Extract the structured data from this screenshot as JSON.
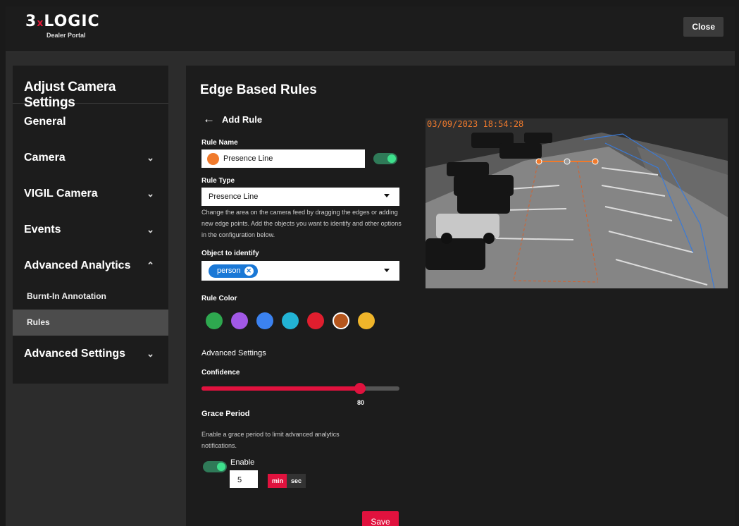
{
  "header": {
    "logo_main_a": "3",
    "logo_x": "x",
    "logo_main_b": "LOGIC",
    "logo_sub": "Dealer Portal",
    "close_label": "Close"
  },
  "sidebar": {
    "title": "Adjust Camera Settings",
    "items": [
      {
        "label": "General",
        "chevron": ""
      },
      {
        "label": "Camera",
        "chevron": "⌄"
      },
      {
        "label": "VIGIL Camera",
        "chevron": "⌄"
      },
      {
        "label": "Events",
        "chevron": "⌄"
      },
      {
        "label": "Advanced Analytics",
        "chevron": "⌃"
      }
    ],
    "subitems": [
      {
        "label": "Burnt-In Annotation",
        "active": false
      },
      {
        "label": "Rules",
        "active": true
      }
    ],
    "bottom_item": {
      "label": "Advanced Settings",
      "chevron": "⌄"
    }
  },
  "main": {
    "title": "Edge Based Rules",
    "back_label": "Add Rule",
    "rule_name_label": "Rule Name",
    "rule_name_value": "Presence Line",
    "rule_enabled": true,
    "rule_type_label": "Rule Type",
    "rule_type_value": "Presence Line",
    "help_text": "Change the area on the camera feed by dragging the edges or adding new edge points. Add the objects you want to identify and other options in the configuration below.",
    "object_label": "Object to identify",
    "object_chip": "person",
    "rule_color_label": "Rule Color",
    "rule_colors": [
      "#2ea84f",
      "#a259e6",
      "#3b82f0",
      "#22b3d4",
      "#e01e2e",
      "#b5561d",
      "#f0b52a"
    ],
    "selected_color_index": 5,
    "advanced_settings_label": "Advanced Settings",
    "confidence_label": "Confidence",
    "confidence_value": "80",
    "grace_period_label": "Grace Period",
    "grace_help": "Enable a grace period to limit advanced analytics notifications.",
    "enable_label": "Enable",
    "grace_enabled": true,
    "grace_value": "5",
    "unit_min": "min",
    "unit_sec": "sec",
    "save_label": "Save"
  },
  "camera": {
    "timestamp": "03/09/2023 18:54:28"
  },
  "colors": {
    "accent": "#e0123e",
    "toggle_on": "#3ee08c",
    "chip": "#1a78d6",
    "line": "#f07a2c"
  }
}
